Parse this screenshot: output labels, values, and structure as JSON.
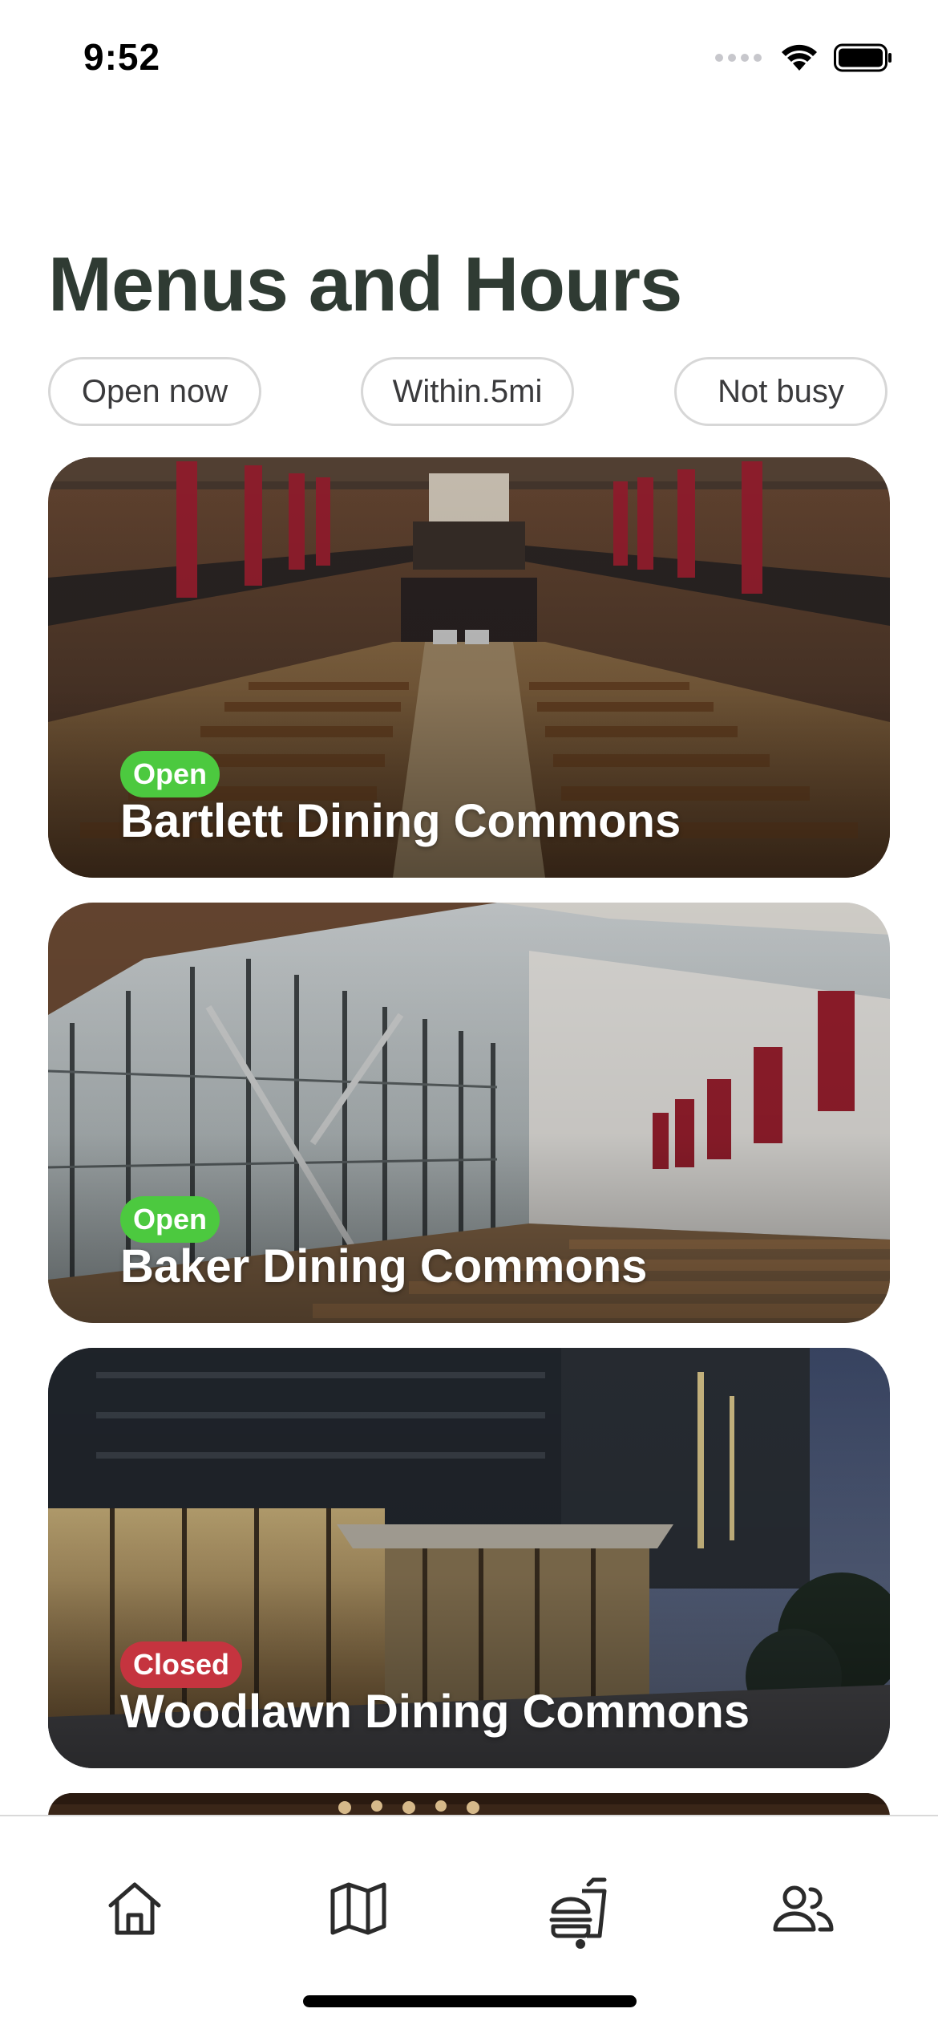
{
  "status_bar": {
    "time": "9:52",
    "icons": [
      "cellular-signal-icon",
      "wifi-icon",
      "battery-icon"
    ]
  },
  "header": {
    "title": "Menus and Hours"
  },
  "filters": [
    {
      "label": "Open now"
    },
    {
      "label": "Within.5mi"
    },
    {
      "label": "Not busy"
    }
  ],
  "dining_halls": [
    {
      "name": "Bartlett Dining Commons",
      "status": "Open"
    },
    {
      "name": "Baker Dining Commons",
      "status": "Open"
    },
    {
      "name": "Woodlawn Dining Commons",
      "status": "Closed"
    }
  ],
  "tab_bar": {
    "tabs": [
      {
        "icon": "home-icon",
        "selected": false
      },
      {
        "icon": "map-icon",
        "selected": false
      },
      {
        "icon": "food-icon",
        "selected": true
      },
      {
        "icon": "people-icon",
        "selected": false
      }
    ]
  },
  "colors": {
    "title": "#2f3b33",
    "open_badge": "#4cc93f",
    "closed_badge": "#c5343f",
    "chip_border": "#d7d7d7",
    "tab_icon": "#2b2b2b"
  }
}
